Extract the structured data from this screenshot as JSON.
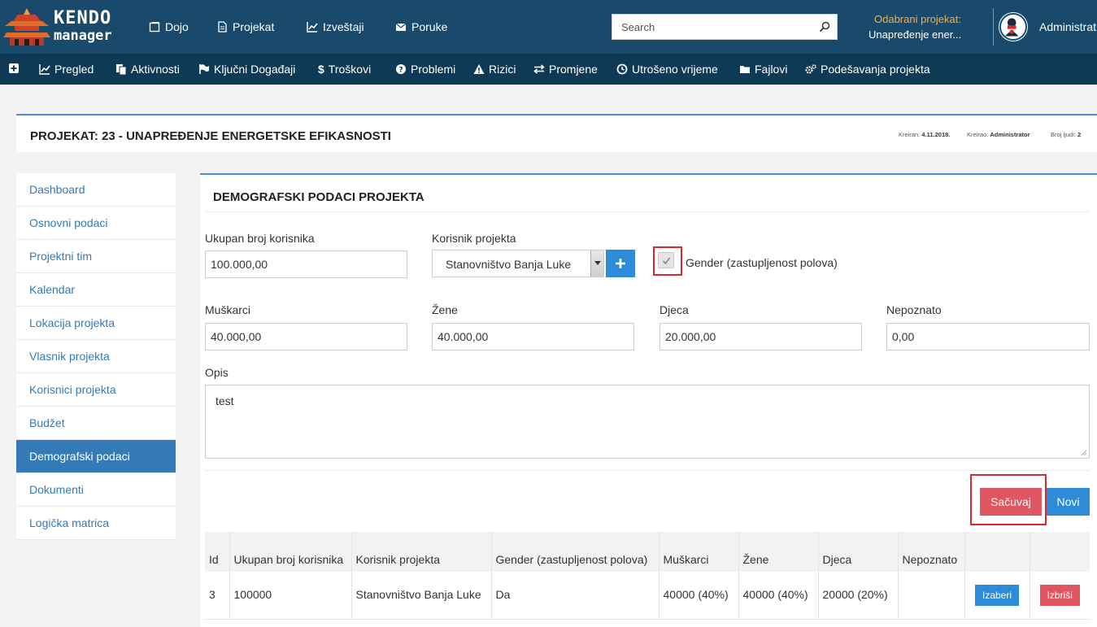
{
  "header": {
    "logo_top": "KENDO",
    "logo_bottom": "manager",
    "nav": [
      {
        "label": "Dojo",
        "icon": "window-icon"
      },
      {
        "label": "Projekat",
        "icon": "document-icon"
      },
      {
        "label": "Izveštaji",
        "icon": "chart-icon"
      },
      {
        "label": "Poruke",
        "icon": "envelope-icon"
      }
    ],
    "search_placeholder": "Search",
    "selected_project_label": "Odabrani projekat:",
    "selected_project_value": "Unapređenje ener...",
    "user_name": "Administrat"
  },
  "subnav": [
    {
      "label": "",
      "icon": "plus-square-icon"
    },
    {
      "label": "Pregled",
      "icon": "line-chart-icon"
    },
    {
      "label": "Aktivnosti",
      "icon": "copy-icon"
    },
    {
      "label": "Ključni Događaji",
      "icon": "flag-icon"
    },
    {
      "label": "Troškovi",
      "icon": "dollar-icon"
    },
    {
      "label": "Problemi",
      "icon": "question-circle-icon"
    },
    {
      "label": "Rizici",
      "icon": "warning-icon"
    },
    {
      "label": "Promjene",
      "icon": "exchange-icon"
    },
    {
      "label": "Utrošeno vrijeme",
      "icon": "clock-icon"
    },
    {
      "label": "Fajlovi",
      "icon": "folder-icon"
    },
    {
      "label": "Podešavanja projekta",
      "icon": "cogs-icon"
    }
  ],
  "project": {
    "title": "PROJEKAT: 23 - UNAPREĐENJE ENERGETSKE EFIKASNOSTI",
    "created_label": "Kreiran:",
    "created_value": "4.11.2018.",
    "created_by_label": "Kreirao:",
    "created_by_value": "Administrator",
    "people_label": "Broj ljudi:",
    "people_value": "2"
  },
  "sidebar": {
    "items": [
      {
        "label": "Dashboard",
        "active": false
      },
      {
        "label": "Osnovni podaci",
        "active": false
      },
      {
        "label": "Projektni tim",
        "active": false
      },
      {
        "label": "Kalendar",
        "active": false
      },
      {
        "label": "Lokacija projekta",
        "active": false
      },
      {
        "label": "Vlasnik projekta",
        "active": false
      },
      {
        "label": "Korisnici projekta",
        "active": false
      },
      {
        "label": "Budžet",
        "active": false
      },
      {
        "label": "Demografski podaci",
        "active": true
      },
      {
        "label": "Dokumenti",
        "active": false
      },
      {
        "label": "Logička matrica",
        "active": false
      }
    ]
  },
  "form": {
    "title": "DEMOGRAFSKI PODACI PROJEKTA",
    "total_label": "Ukupan broj korisnika",
    "total_value": "100.000,00",
    "beneficiary_label": "Korisnik projekta",
    "beneficiary_value": "Stanovništvo Banja Luke",
    "gender_label": "Gender (zastupljenost polova)",
    "gender_checked": true,
    "men_label": "Muškarci",
    "men_value": "40.000,00",
    "women_label": "Žene",
    "women_value": "40.000,00",
    "children_label": "Djeca",
    "children_value": "20.000,00",
    "unknown_label": "Nepoznato",
    "unknown_value": "0,00",
    "desc_label": "Opis",
    "desc_value": "test",
    "save_label": "Sačuvaj",
    "new_label": "Novi",
    "highlight_color": "#d9272e"
  },
  "table": {
    "headers": [
      "Id",
      "Ukupan broj korisnika",
      "Korisnik projekta",
      "Gender (zastupljenost polova)",
      "Muškarci",
      "Žene",
      "Djeca",
      "Nepoznato",
      "",
      ""
    ],
    "rows": [
      {
        "id": "3",
        "total": "100000",
        "beneficiary": "Stanovništvo Banja Luke",
        "gender": "Da",
        "men": "40000 (40%)",
        "women": "40000 (40%)",
        "children": "20000 (20%)",
        "unknown": "",
        "select_label": "Izaberi",
        "delete_label": "Izbriši"
      }
    ]
  }
}
